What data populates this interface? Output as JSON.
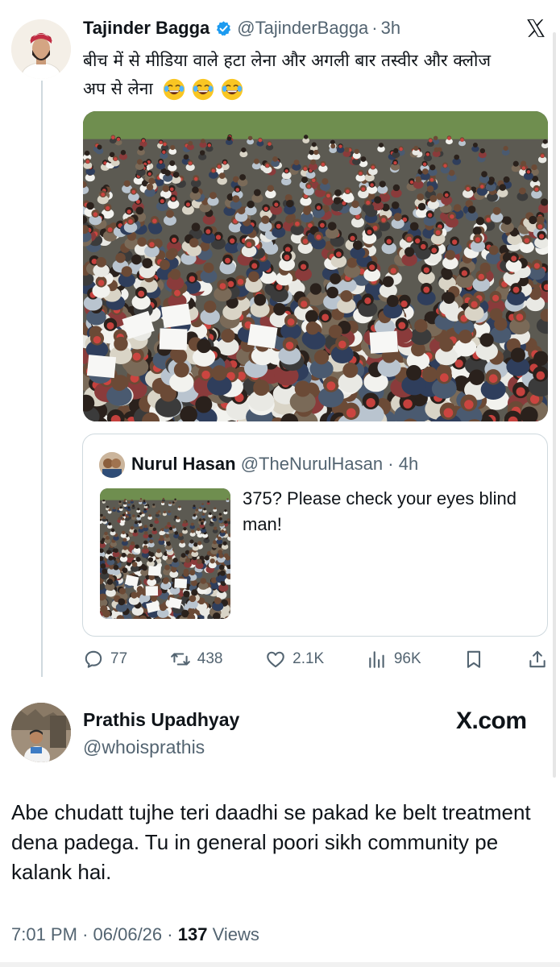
{
  "quoted_tweet": {
    "author_name": "Tajinder Bagga",
    "handle": "@TajinderBagga",
    "separator": "·",
    "time": "3h",
    "text": "बीच में से मीडिया वाले हटा लेना और अगली बार तस्वीर और क्लोज अप से लेना",
    "emojis": [
      "face-with-tears-of-joy",
      "face-with-tears-of-joy",
      "face-with-tears-of-joy"
    ],
    "quote": {
      "author_name": "Nurul Hasan",
      "handle": "@TheNurulHasan",
      "separator": "·",
      "time": "4h",
      "text": "375? Please check your eyes blind man!"
    },
    "actions": {
      "replies": "77",
      "reposts": "438",
      "likes": "2.1K",
      "views": "96K"
    },
    "colors": {
      "verified_badge": "#1d9bf0",
      "muted_text": "#536471",
      "border": "#cfd9de",
      "number_tag": "#d64541"
    }
  },
  "reply": {
    "author_name": "Prathis Upadhyay",
    "handle": "@whoisprathis",
    "brand": "X.com",
    "text": "Abe chudatt tujhe teri daadhi se pakad ke belt treatment dena padega. Tu in general poori sikh community pe kalank hai.",
    "meta": {
      "time": "7:01 PM",
      "separator": "·",
      "date": "06/06/26",
      "views_count": "137",
      "views_label": "Views"
    }
  }
}
